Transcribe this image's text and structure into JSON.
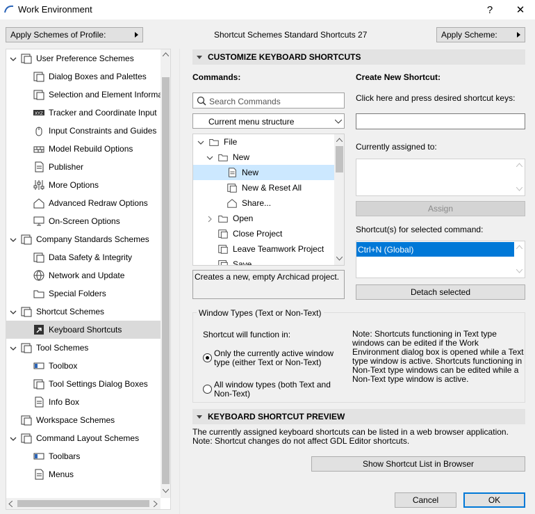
{
  "window": {
    "title": "Work Environment",
    "help": "?",
    "close": "✕"
  },
  "top": {
    "apply_profile": "Apply Schemes of Profile:",
    "scheme_label": "Shortcut Schemes :",
    "scheme_value": "Standard Shortcuts 27",
    "apply_scheme": "Apply Scheme:"
  },
  "tree": [
    {
      "label": "User Preference Schemes",
      "icon": "user-preference-icon",
      "level": 0,
      "expanded": true
    },
    {
      "label": "Dialog Boxes and Palettes",
      "icon": "dialog-boxes-icon",
      "level": 1
    },
    {
      "label": "Selection and Element Informatio",
      "icon": "selection-icon",
      "level": 1
    },
    {
      "label": "Tracker and Coordinate Input",
      "icon": "xyz-tracker-icon",
      "level": 1
    },
    {
      "label": "Input Constraints and Guides",
      "icon": "mouse-icon",
      "level": 1
    },
    {
      "label": "Model Rebuild Options",
      "icon": "bricks-icon",
      "level": 1
    },
    {
      "label": "Publisher",
      "icon": "publisher-icon",
      "level": 1
    },
    {
      "label": "More Options",
      "icon": "sliders-icon",
      "level": 1
    },
    {
      "label": "Advanced Redraw Options",
      "icon": "redraw-house-icon",
      "level": 1
    },
    {
      "label": "On-Screen Options",
      "icon": "monitor-icon",
      "level": 1
    },
    {
      "label": "Company Standards Schemes",
      "icon": "company-standards-icon",
      "level": 0,
      "expanded": true
    },
    {
      "label": "Data Safety & Integrity",
      "icon": "data-safety-icon",
      "level": 1
    },
    {
      "label": "Network and Update",
      "icon": "globe-icon",
      "level": 1
    },
    {
      "label": "Special Folders",
      "icon": "folders-icon",
      "level": 1
    },
    {
      "label": "Shortcut Schemes",
      "icon": "shortcut-schemes-icon",
      "level": 0,
      "expanded": true
    },
    {
      "label": "Keyboard Shortcuts",
      "icon": "shortcut-arrow-icon",
      "level": 1,
      "selected": true
    },
    {
      "label": "Tool Schemes",
      "icon": "tool-schemes-icon",
      "level": 0,
      "expanded": true
    },
    {
      "label": "Toolbox",
      "icon": "toolbox-icon",
      "level": 1
    },
    {
      "label": "Tool Settings Dialog Boxes",
      "icon": "tool-settings-icon",
      "level": 1
    },
    {
      "label": "Info Box",
      "icon": "info-box-icon",
      "level": 1
    },
    {
      "label": "Workspace Schemes",
      "icon": "workspace-icon",
      "level": 0,
      "noarrow": true
    },
    {
      "label": "Command Layout Schemes",
      "icon": "command-layout-icon",
      "level": 0,
      "expanded": true
    },
    {
      "label": "Toolbars",
      "icon": "toolbars-icon",
      "level": 1
    },
    {
      "label": "Menus",
      "icon": "menus-icon",
      "level": 1
    }
  ],
  "customize": {
    "header": "CUSTOMIZE KEYBOARD SHORTCUTS",
    "commands_label": "Commands:",
    "search_placeholder": "Search Commands",
    "menu_structure": "Current menu structure",
    "commands": [
      {
        "label": "File",
        "icon": "folder-icon",
        "level": 0,
        "arrow": "down"
      },
      {
        "label": "New",
        "icon": "new-folder-icon",
        "level": 1,
        "arrow": "down"
      },
      {
        "label": "New",
        "icon": "new-document-icon",
        "level": 2,
        "selected": true
      },
      {
        "label": "New & Reset All",
        "icon": "new-reset-icon",
        "level": 2
      },
      {
        "label": "Share...",
        "icon": "share-house-icon",
        "level": 2
      },
      {
        "label": "Open",
        "icon": "open-folder-icon",
        "level": 1,
        "arrow": "right"
      },
      {
        "label": "Close Project",
        "icon": "close-project-icon",
        "level": 1
      },
      {
        "label": "Leave Teamwork Project",
        "icon": "teamwork-icon",
        "level": 1
      },
      {
        "label": "Save",
        "icon": "save-icon",
        "level": 1
      }
    ],
    "description": "Creates a new, empty Archicad project.",
    "create_label": "Create New Shortcut:",
    "press_keys": "Click here and press desired shortcut keys:",
    "shortcut_value": "",
    "assigned_label": "Currently assigned to:",
    "assign_button": "Assign",
    "selected_label": "Shortcut(s) for selected command:",
    "shortcuts": [
      "Ctrl+N (Global)"
    ],
    "detach_button": "Detach selected"
  },
  "window_types": {
    "legend": "Window Types (Text or Non-Text)",
    "function_in": "Shortcut will function in:",
    "option1": "Only the currently active window type (either Text or Non-Text)",
    "option2": "All window types (both Text and Non-Text)",
    "selected_option": 1,
    "note": "Note: Shortcuts functioning in Text type windows can be edited if the Work Environment dialog box is opened while a Text type window is active. Shortcuts functioning in Non-Text type windows can be edited while a Non-Text type window is active."
  },
  "preview": {
    "header": "KEYBOARD SHORTCUT PREVIEW",
    "line1": "The currently assigned keyboard shortcuts can be listed in a web browser application.",
    "line2": "Note: Shortcut changes do not affect GDL Editor shortcuts.",
    "button": "Show Shortcut List in Browser"
  },
  "footer": {
    "cancel": "Cancel",
    "ok": "OK"
  }
}
